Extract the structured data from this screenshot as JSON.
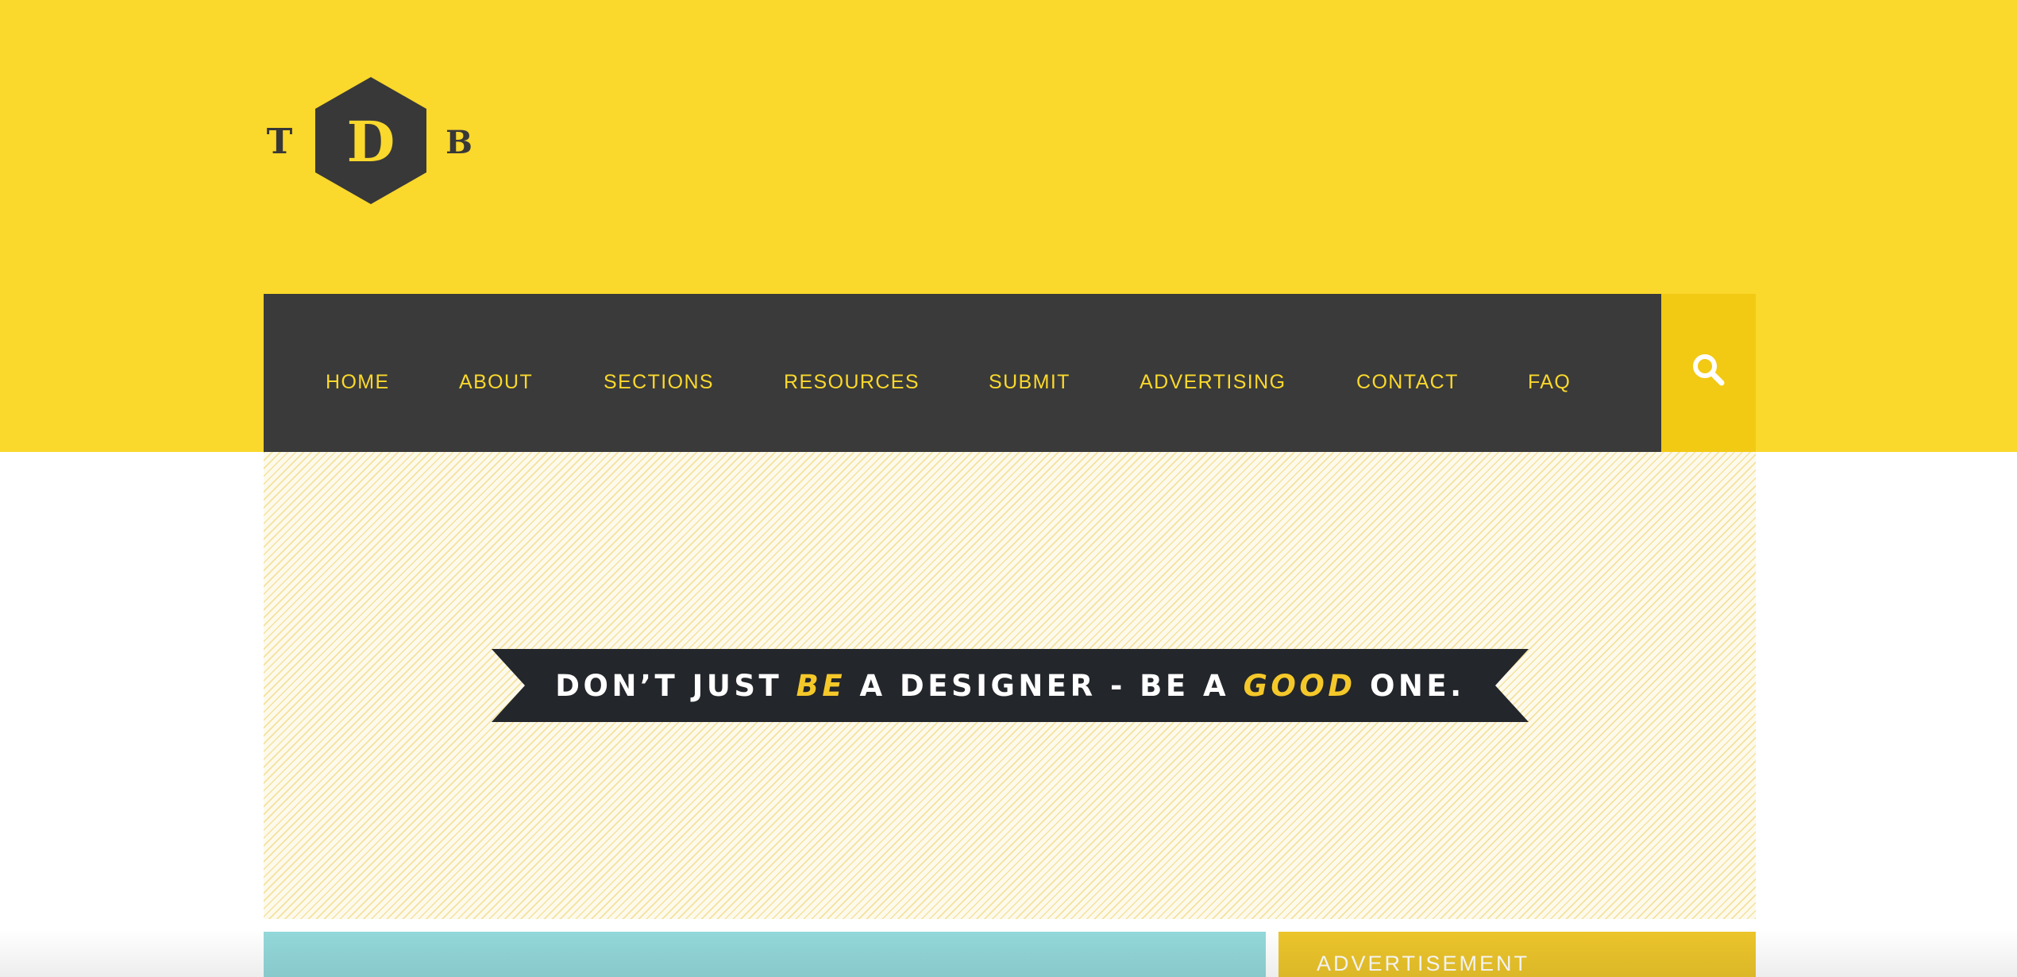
{
  "logo": {
    "letters": [
      "T",
      "D",
      "B"
    ],
    "icon": "hexagon-logo-icon"
  },
  "nav": {
    "items": [
      {
        "label": "HOME"
      },
      {
        "label": "ABOUT"
      },
      {
        "label": "SECTIONS"
      },
      {
        "label": "RESOURCES"
      },
      {
        "label": "SUBMIT"
      },
      {
        "label": "ADVERTISING"
      },
      {
        "label": "CONTACT"
      },
      {
        "label": "FAQ"
      }
    ],
    "search_icon": "search-icon"
  },
  "hero": {
    "banner": {
      "part1": "DON’T JUST ",
      "highlight1": "BE",
      "part2": " A DESIGNER - BE A ",
      "highlight2": "GOOD",
      "part3": " ONE."
    }
  },
  "sidebar": {
    "ad_label": "ADVERTISEMENT"
  },
  "colors": {
    "brand_yellow": "#fad82c",
    "nav_dark": "#3a3a3a",
    "search_yellow": "#f2c913",
    "content_teal": "#93d8da",
    "ad_yellow": "#ecc52b"
  }
}
